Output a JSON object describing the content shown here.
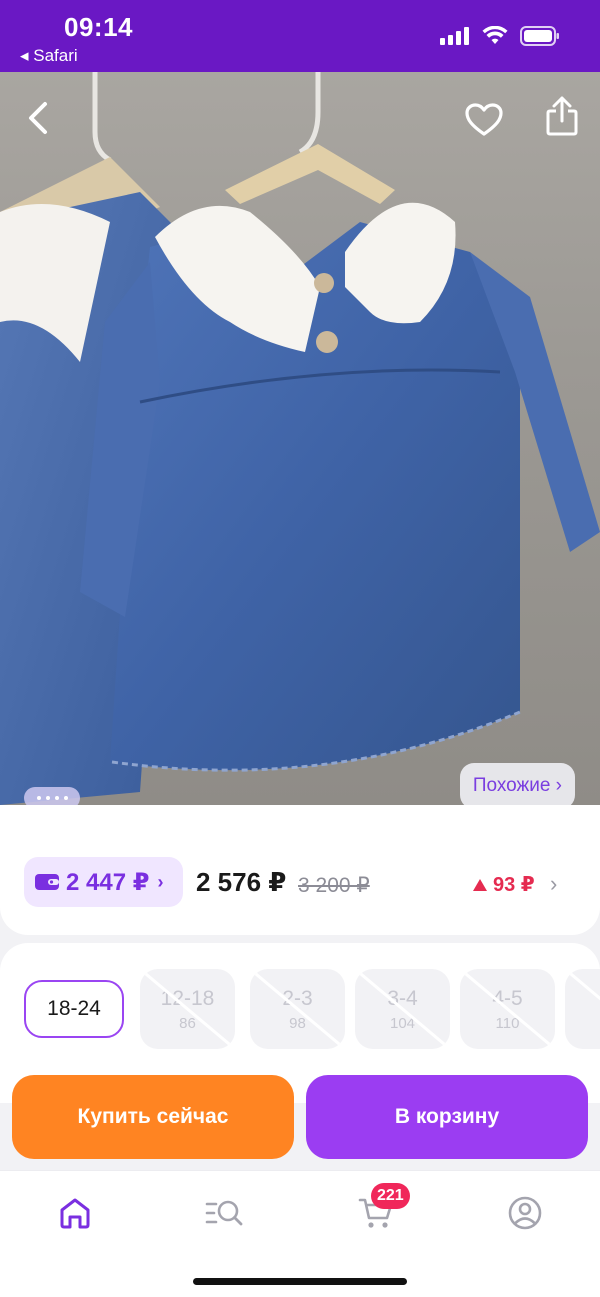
{
  "status_bar": {
    "time": "09:14",
    "back_app": "◂ Safari"
  },
  "hero": {
    "back_icon": "chevron-left-icon",
    "favorite_icon": "heart-outline-icon",
    "share_icon": "share-icon",
    "similar_label": "Похожие ›"
  },
  "price": {
    "wallet_price": "2 447 ₽",
    "wallet_chevron": "›",
    "price": "2 576 ₽",
    "old_price": "3 200 ₽",
    "delta": "93 ₽",
    "delta_color": "#e52b50",
    "chevron": "›"
  },
  "sizes": [
    {
      "label": "18-24",
      "sub": "",
      "available": true,
      "selected": true
    },
    {
      "label": "12-18",
      "sub": "86",
      "available": false,
      "selected": false
    },
    {
      "label": "2-3",
      "sub": "98",
      "available": false,
      "selected": false
    },
    {
      "label": "3-4",
      "sub": "104",
      "available": false,
      "selected": false
    },
    {
      "label": "4-5",
      "sub": "110",
      "available": false,
      "selected": false
    }
  ],
  "actions": {
    "buy_now": "Купить сейчас",
    "add_to_cart": "В корзину"
  },
  "tabbar": {
    "items": [
      {
        "name": "home-icon",
        "active": true
      },
      {
        "name": "catalog-search-icon",
        "active": false
      },
      {
        "name": "cart-icon",
        "active": false
      },
      {
        "name": "profile-icon",
        "active": false
      }
    ],
    "cart_badge": "221"
  },
  "colors": {
    "brand": "#6a18c4",
    "accent": "#9b3df2",
    "buy": "#ff8422",
    "badge": "#f0275a"
  }
}
